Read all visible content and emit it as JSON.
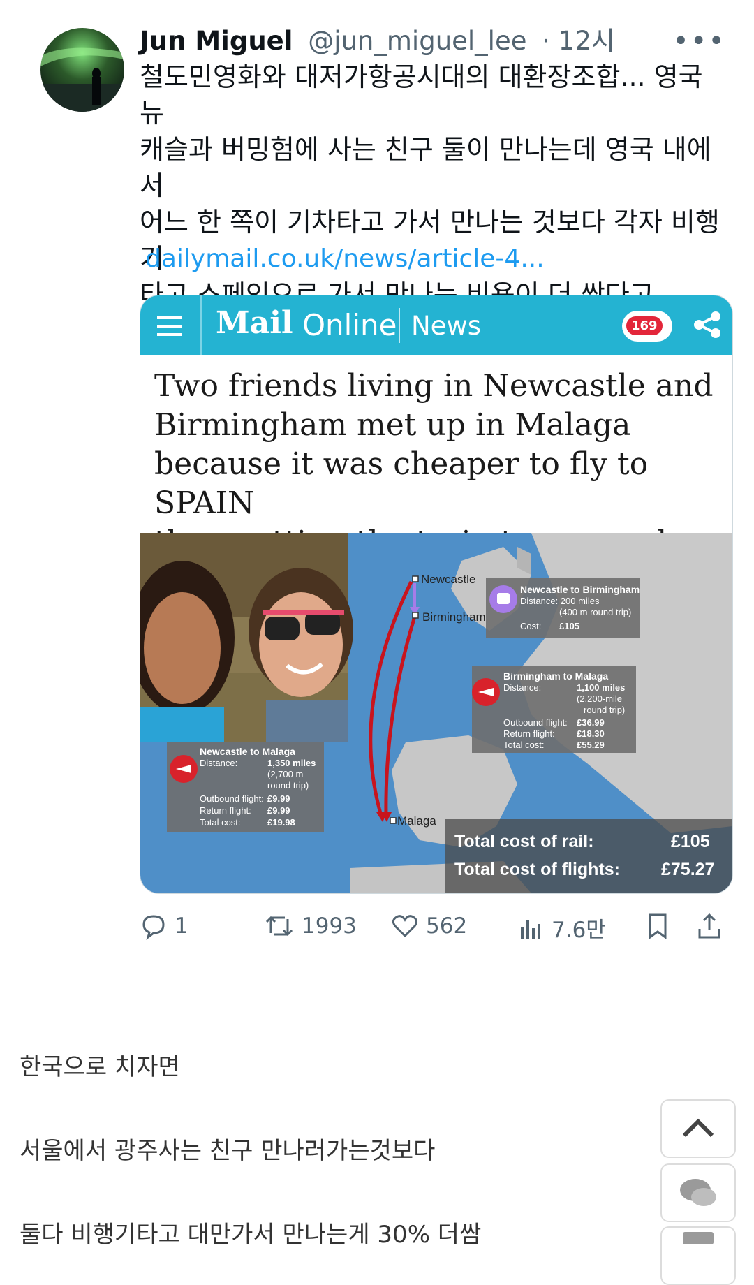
{
  "tweet": {
    "author_name": "Jun Miguel",
    "handle": "@jun_miguel_lee",
    "time": "· 12시",
    "more_icon": "more-dots-icon",
    "text": "철도민영화와 대저가항공시대의 대환장조합... 영국 뉴\n캐슬과 버밍험에 사는 친구 둘이 만나는데 영국 내에서\n어느 한 쪽이 기차타고 가서 만나는 것보다 각자 비행기\n타고 스페인으로 가서 만나는 비용이 더 쌌다고.",
    "link": "dailymail.co.uk/news/article-4..."
  },
  "card": {
    "mail_logo": "Mail",
    "online": "Online",
    "section": "News",
    "comment_count": "169",
    "headline": "Two friends living in Newcastle and\nBirmingham met up in Malaga\nbecause it was cheaper to fly to SPAIN\nthan getting the train to see each other",
    "map": {
      "city_newcastle": "Newcastle",
      "city_birmingham": "Birmingham",
      "city_malaga": "Malaga",
      "rail_box": {
        "title": "Newcastle to Birmingham",
        "distance": "Distance: 200 miles",
        "round_trip": "(400 m round trip)",
        "cost_label": "Cost:",
        "cost": "£105"
      },
      "bham_malaga_box": {
        "title": "Birmingham to Malaga",
        "distance_label": "Distance:",
        "distance": "1,100 miles",
        "round_trip_1": "(2,200-mile",
        "round_trip_2": "round trip)",
        "outbound_label": "Outbound flight:",
        "outbound": "£36.99",
        "return_label": "Return flight:",
        "return": "£18.30",
        "total_label": "Total cost:",
        "total": "£55.29"
      },
      "ncl_malaga_box": {
        "title": "Newcastle to Malaga",
        "distance_label": "Distance:",
        "distance": "1,350 miles",
        "round_trip_1": "(2,700 m",
        "round_trip_2": "round trip)",
        "outbound_label": "Outbound flight:",
        "outbound": "£9.99",
        "return_label": "Return flight:",
        "return": "£9.99",
        "total_label": "Total cost:",
        "total": "£19.98"
      },
      "total_rail_label": "Total cost of rail:",
      "total_rail": "£105",
      "total_flights_label": "Total cost of flights:",
      "total_flights": "£75.27"
    }
  },
  "metrics": {
    "replies": "1",
    "retweets": "1993",
    "likes": "562",
    "views": "7.6만"
  },
  "comments": [
    "한국으로 치자면",
    "서울에서 광주사는 친구 만나러가는것보다",
    "둘다 비행기타고 대만가서 만나는게 30% 더쌈"
  ]
}
